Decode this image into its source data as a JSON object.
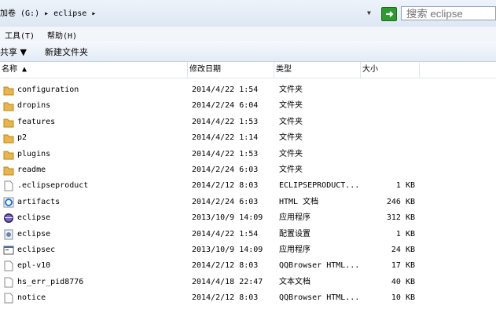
{
  "address": {
    "path": "加卷 (G:) ▸ eclipse ▸",
    "search_placeholder": "搜索 eclipse"
  },
  "menu": {
    "tools": "工具(T)",
    "help": "帮助(H)"
  },
  "toolbar": {
    "share": "共享 ▼",
    "new_folder": "新建文件夹"
  },
  "columns": {
    "name": "名称 ▲",
    "date": "修改日期",
    "type": "类型",
    "size": "大小"
  },
  "colors": {
    "folder": "#e8b64a",
    "selection": "#cce8ff"
  },
  "files": [
    {
      "name": "configuration",
      "date": "2014/4/22 1:54",
      "type": "文件夹",
      "size": "",
      "icon": "folder"
    },
    {
      "name": "dropins",
      "date": "2014/2/24 6:04",
      "type": "文件夹",
      "size": "",
      "icon": "folder"
    },
    {
      "name": "features",
      "date": "2014/4/22 1:53",
      "type": "文件夹",
      "size": "",
      "icon": "folder"
    },
    {
      "name": "p2",
      "date": "2014/4/22 1:14",
      "type": "文件夹",
      "size": "",
      "icon": "folder"
    },
    {
      "name": "plugins",
      "date": "2014/4/22 1:53",
      "type": "文件夹",
      "size": "",
      "icon": "folder"
    },
    {
      "name": "readme",
      "date": "2014/2/24 6:03",
      "type": "文件夹",
      "size": "",
      "icon": "folder"
    },
    {
      "name": ".eclipseproduct",
      "date": "2014/2/12 8:03",
      "type": "ECLIPSEPRODUCT...",
      "size": "1 KB",
      "icon": "file"
    },
    {
      "name": "artifacts",
      "date": "2014/2/24 6:03",
      "type": "HTML 文档",
      "size": "246 KB",
      "icon": "html"
    },
    {
      "name": "eclipse",
      "date": "2013/10/9 14:09",
      "type": "应用程序",
      "size": "312 KB",
      "icon": "eclipse"
    },
    {
      "name": "eclipse",
      "date": "2014/4/22 1:54",
      "type": "配置设置",
      "size": "1 KB",
      "icon": "config"
    },
    {
      "name": "eclipsec",
      "date": "2013/10/9 14:09",
      "type": "应用程序",
      "size": "24 KB",
      "icon": "console"
    },
    {
      "name": "epl-v10",
      "date": "2014/2/12 8:03",
      "type": "QQBrowser HTML...",
      "size": "17 KB",
      "icon": "file"
    },
    {
      "name": "hs_err_pid8776",
      "date": "2014/4/18 22:47",
      "type": "文本文档",
      "size": "40 KB",
      "icon": "file"
    },
    {
      "name": "notice",
      "date": "2014/2/12 8:03",
      "type": "QQBrowser HTML...",
      "size": "10 KB",
      "icon": "file"
    }
  ]
}
